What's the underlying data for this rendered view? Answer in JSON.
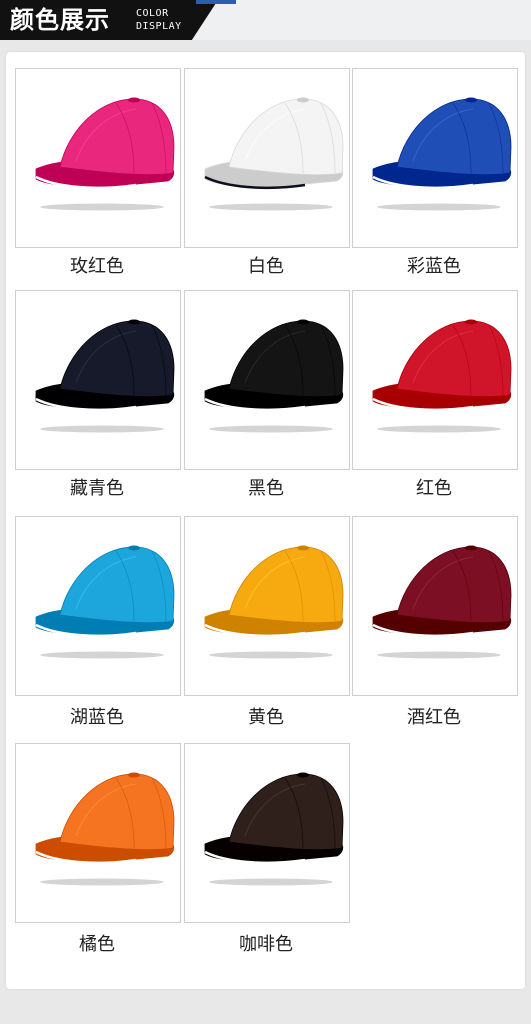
{
  "header": {
    "title": "颜色展示",
    "subtitle_line1": "COLOR",
    "subtitle_line2": "DISPLAY"
  },
  "colors": [
    {
      "label": "玫红色",
      "hex": "#e8277d"
    },
    {
      "label": "白色",
      "hex": "#f4f4f4"
    },
    {
      "label": "彩蓝色",
      "hex": "#1f4fb6"
    },
    {
      "label": "藏青色",
      "hex": "#161a2a"
    },
    {
      "label": "黑色",
      "hex": "#141414"
    },
    {
      "label": "红色",
      "hex": "#d0142a"
    },
    {
      "label": "湖蓝色",
      "hex": "#1ca6dc"
    },
    {
      "label": "黄色",
      "hex": "#f6aa10"
    },
    {
      "label": "酒红色",
      "hex": "#7c0f24"
    },
    {
      "label": "橘色",
      "hex": "#f47421"
    },
    {
      "label": "咖啡色",
      "hex": "#2f201b"
    }
  ]
}
